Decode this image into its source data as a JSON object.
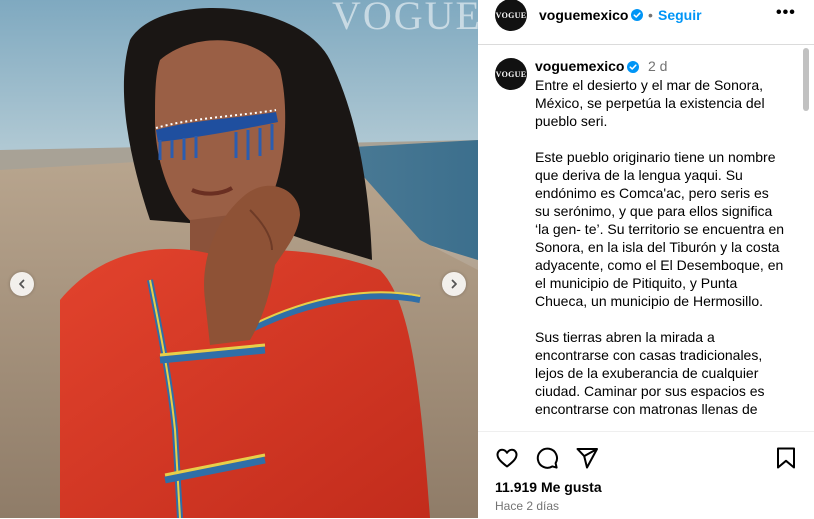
{
  "post": {
    "magazine_wordmark": "VOGUE",
    "images": {
      "has_prev": true,
      "has_next": true
    }
  },
  "header": {
    "username": "voguemexico",
    "avatar_text": "VOGUE",
    "separator": "•",
    "follow_label": "Seguir",
    "more_label": "•••"
  },
  "caption": {
    "username": "voguemexico",
    "time": "2 d",
    "paragraphs": [
      "Entre el desierto y el mar de Sonora, México, se perpetúa la existencia del pueblo seri.",
      "Este pueblo originario tiene un nombre que deriva de la lengua yaqui. Su endónimo es Comca'ac, pero seris es su serónimo, y que para ellos significa ‘la gen- te’. Su territorio se encuentra en Sonora, en la isla del Tiburón y la costa adyacente, como el El Desemboque, en el municipio de Pitiquito, y Punta Chueca, un municipio de Hermosillo.",
      "Sus tierras abren la mirada a encontrarse con casas tradicionales, lejos de la exuberancia de cualquier ciudad. Caminar por sus espacios es encontrarse con matronas llenas de"
    ]
  },
  "actions": {
    "icons": [
      "heart-icon",
      "comment-icon",
      "share-icon",
      "bookmark-icon"
    ],
    "likes": "11.919 Me gusta",
    "posted_ago": "Hace 2 días"
  },
  "colors": {
    "accent": "#0095f6",
    "verified": "#0095f6",
    "muted": "#737373",
    "border": "#dbdbdb"
  }
}
